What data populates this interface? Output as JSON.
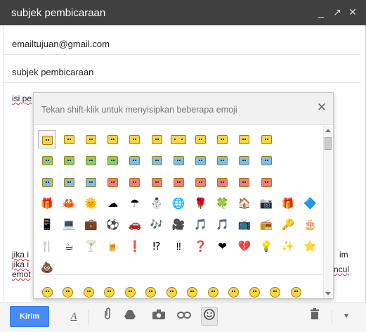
{
  "window": {
    "title": "subjek pembicaraan",
    "controls": {
      "minimize": "_",
      "popout": "↗",
      "close": "✕"
    }
  },
  "to_field": {
    "value": "emailtujuan@gmail.com"
  },
  "subject_field": {
    "value": "subjek pembicaraan"
  },
  "body": {
    "first_line": "isi pe",
    "bottom_lines": [
      "jika i",
      "jika i",
      "emot"
    ],
    "right_fragments": [
      "im",
      "ncul"
    ]
  },
  "emoji_picker": {
    "hint": "Tekan shift-klik untuk menyisipkan beberapa emoji",
    "close_label": "✕",
    "rows": [
      [
        "face",
        "face",
        "face",
        "face",
        "face",
        "face",
        "face-wide",
        "face",
        "face",
        "face",
        "face"
      ],
      [
        "face-green",
        "face-green",
        "face-green",
        "face-green",
        "face-blue",
        "face-blue",
        "face-blue",
        "face-blue",
        "face-blue",
        "face-blue",
        "face-blue"
      ],
      [
        "face-blue",
        "face-blue",
        "face-blue",
        "face-red",
        "face-red",
        "face-red",
        "face-red",
        "face-red",
        "face-red",
        "face-red",
        "face-red"
      ],
      [
        "🎁",
        "🦀",
        "🌞",
        "☁",
        "☂",
        "⛄",
        "🌐",
        "🌹",
        "🍀",
        "🏠",
        "📷",
        "🎁",
        "🔷"
      ],
      [
        "📱",
        "💻",
        "💼",
        "⚽",
        "🚗",
        "🎶",
        "🎥",
        "🎵",
        "🎵",
        "📺",
        "📻",
        "🔑",
        "🎂"
      ],
      [
        "🍴",
        "☕",
        "🍸",
        "🍺",
        "❗",
        "⁉",
        "‼",
        "❓",
        "❤",
        "💔",
        "💡",
        "✨",
        "⭐"
      ],
      [
        "💩"
      ]
    ],
    "footer_row": [
      "☺",
      "☺",
      "☺",
      "☺",
      "☺",
      "☺",
      "☺",
      "☺",
      "☺",
      "☺",
      "☺",
      "😎",
      "☺"
    ],
    "colors": {
      "yellow": "#f6d64a",
      "green": "#7ed07a",
      "blue": "#7cc1ea",
      "red": "#f07f7f"
    }
  },
  "toolbar": {
    "send_label": "Kirim",
    "icons": [
      "text-format-icon",
      "attach-icon",
      "drive-icon",
      "camera-icon",
      "link-icon",
      "emoji-icon",
      "trash-icon",
      "more-options-icon"
    ]
  }
}
